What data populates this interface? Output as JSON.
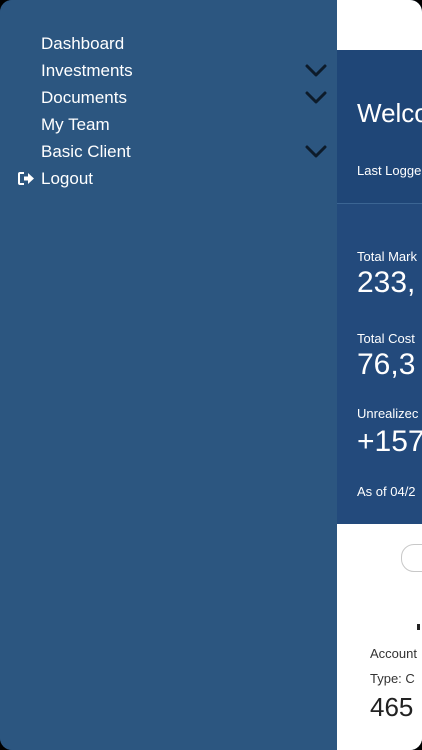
{
  "sidebar": {
    "items": [
      {
        "label": "Dashboard",
        "has_chevron": false,
        "icon": ""
      },
      {
        "label": "Investments",
        "has_chevron": true,
        "icon": ""
      },
      {
        "label": "Documents",
        "has_chevron": true,
        "icon": ""
      },
      {
        "label": "My Team",
        "has_chevron": false,
        "icon": ""
      },
      {
        "label": "Basic Client",
        "has_chevron": true,
        "icon": ""
      },
      {
        "label": "Logout",
        "has_chevron": false,
        "icon": "logout-icon"
      }
    ]
  },
  "main": {
    "welcome_title": "Welco",
    "last_logged": "Last Logge",
    "summary": {
      "total_market_label": "Total Mark",
      "total_market_value": "233,",
      "total_cost_label": "Total Cost",
      "total_cost_value": "76,3",
      "unrealized_label": "Unrealizec",
      "unrealized_value": "+157",
      "as_of": "As of  04/2"
    },
    "card": {
      "account_label": "Account",
      "type_label": "Type:  C",
      "account_value": "465"
    }
  },
  "colors": {
    "sidebar_bg": "#2c5680",
    "header_bg": "#1f4677",
    "summary_bg": "#234a7c",
    "text": "#ffffff"
  }
}
